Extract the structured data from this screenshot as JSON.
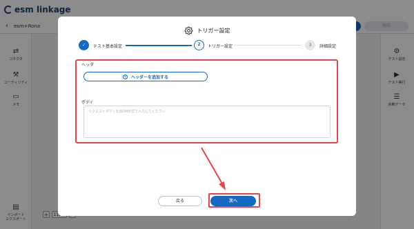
{
  "app": {
    "logo_text": "esm linkage",
    "project_name": "esm+Rona",
    "top_grey_button": "保存",
    "left_nav": [
      {
        "icon": "swap-icon",
        "label": "コネクタ"
      },
      {
        "icon": "utility-icon",
        "label": "ユーティリティ"
      },
      {
        "icon": "memo-icon",
        "label": "メモ"
      },
      {
        "icon": "import-export-icon",
        "label": "インポート\nエクスポート"
      }
    ],
    "right_nav": [
      {
        "icon": "gear-icon",
        "label": "テスト設定"
      },
      {
        "icon": "play-icon",
        "label": "テスト実行"
      },
      {
        "icon": "list-icon",
        "label": "余剰データ"
      }
    ],
    "zoom": {
      "minus": "−",
      "value": "110%",
      "plus": "+"
    }
  },
  "modal": {
    "title": "トリガー設定",
    "steps": [
      {
        "number": "✓",
        "label": "テスト基本設定",
        "status": "done"
      },
      {
        "number": "2",
        "label": "トリガー設定",
        "status": "active"
      },
      {
        "number": "3",
        "label": "詳細設定",
        "status": "todo"
      }
    ],
    "header_section": {
      "label": "ヘッダ",
      "add_button_label": "ヘッダーを追加する"
    },
    "body_section": {
      "label": "ボディ",
      "placeholder": "リクエストボディをJSON形式で入力してください"
    },
    "back_label": "戻る",
    "next_label": "次へ"
  },
  "colors": {
    "primary": "#1669c1",
    "highlight_red": "#e3454d",
    "overlay": "rgba(0,0,0,0.45)"
  }
}
